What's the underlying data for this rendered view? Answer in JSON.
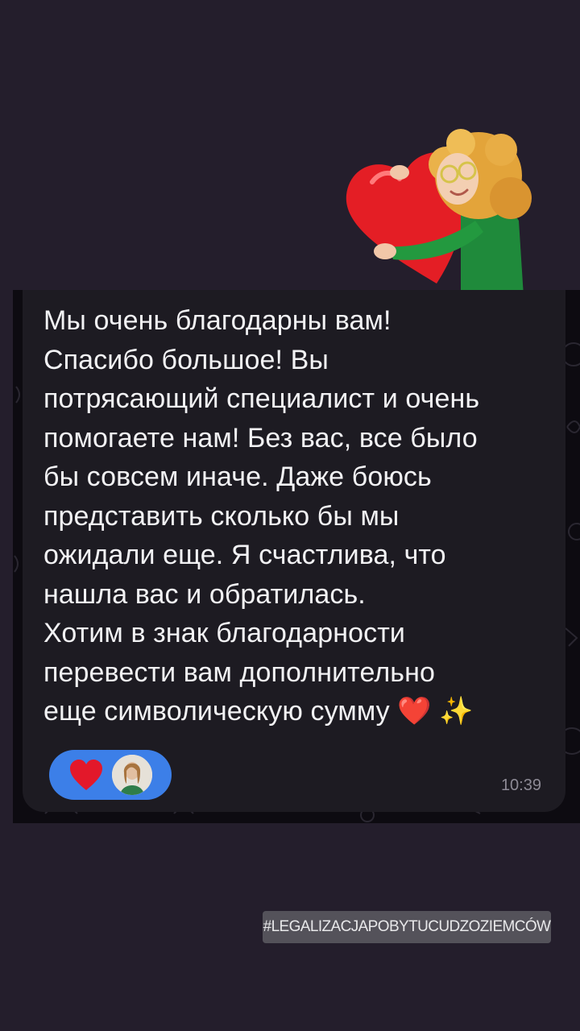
{
  "message": {
    "lines": [
      "Мы очень благодарны вам!",
      "Спасибо большое! Вы",
      "потрясающий специалист и очень",
      "помогаете нам! Без вас, все было",
      "бы совсем иначе. Даже боюсь",
      "представить сколько бы мы",
      "ожидали еще. Я счастлива, что",
      "нашла вас и обратилась.",
      "Хотим в знак благодарности",
      "перевести вам дополнительно",
      "еще символическую сумму ❤️ ✨"
    ],
    "time": "10:39"
  },
  "reaction": {
    "emoji_icon": "red-heart-icon",
    "avatar": "user-avatar",
    "pill_color": "#3c7fe8"
  },
  "sticker": {
    "icon": "woman-hugging-heart-sticker"
  },
  "hashtag": "#LEGALIZACJAPOBYTUCUDZOZIEMCÓW",
  "colors": {
    "background": "#241e2c",
    "chat_background": "#0d0b11",
    "bubble": "#1d1b22",
    "text": "#f2f2f4",
    "timestamp": "#8d8a95"
  }
}
